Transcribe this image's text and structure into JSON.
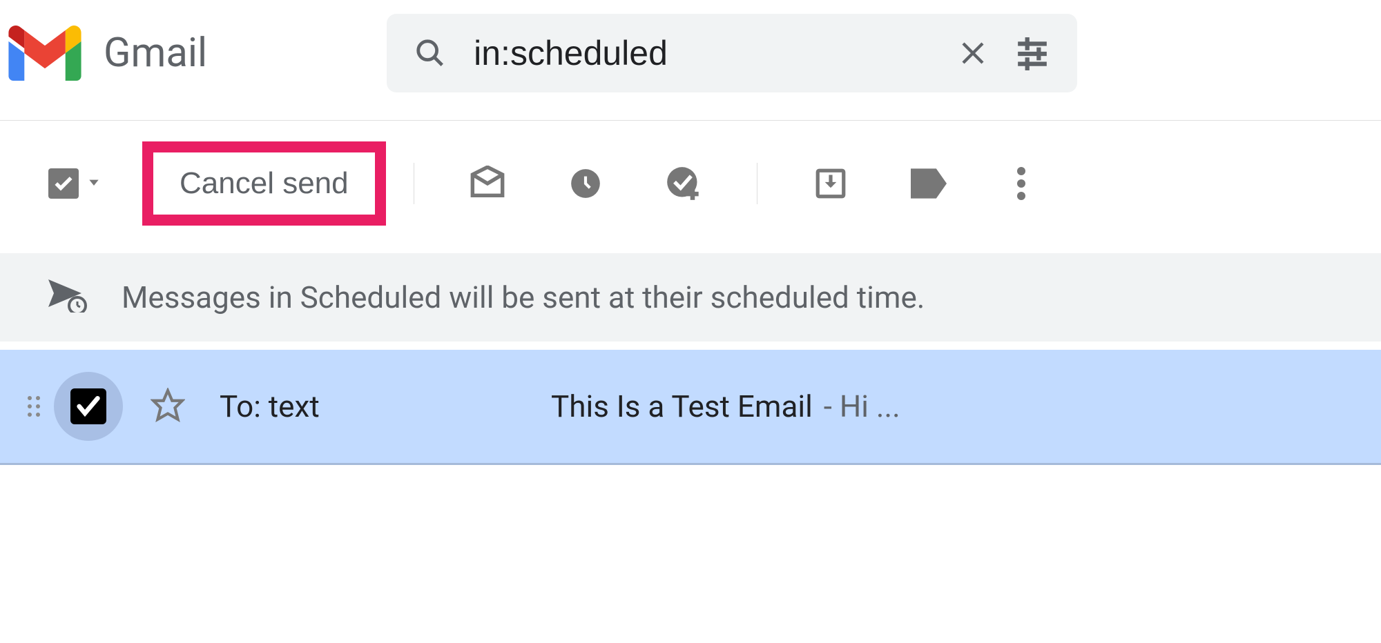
{
  "header": {
    "app_name": "Gmail",
    "search_value": "in:scheduled"
  },
  "toolbar": {
    "cancel_send_label": "Cancel send"
  },
  "banner": {
    "message": "Messages in Scheduled will be sent at their scheduled time."
  },
  "emails": [
    {
      "sender": "To: text",
      "subject": "This Is a Test Email",
      "preview": "- Hi ..."
    }
  ]
}
